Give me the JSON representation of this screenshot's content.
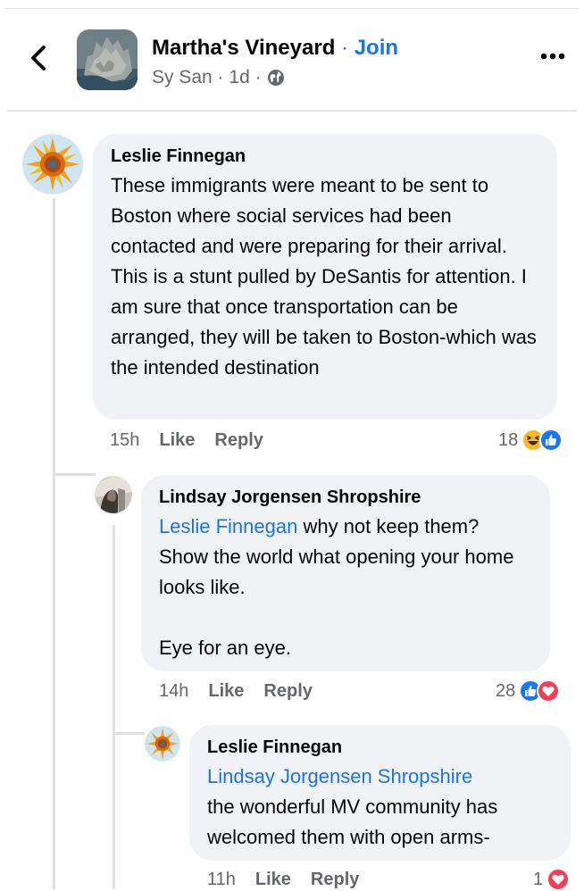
{
  "header": {
    "group_name": "Martha's Vineyard",
    "separator": " · ",
    "join_label": "Join",
    "author": "Sy San",
    "time": "1d"
  },
  "comments": [
    {
      "author": "Leslie Finnegan",
      "mention": "",
      "text": "These immigrants were meant to be sent to Boston where social services had been contacted and were preparing for their arrival. This is a stunt pulled by DeSantis for attention. I am sure that once transportation can be arranged, they will be taken to Boston-which was the intended destination",
      "time": "15h",
      "like_label": "Like",
      "reply_label": "Reply",
      "reaction_count": "18",
      "reactions": [
        "haha-icon",
        "like-icon"
      ]
    },
    {
      "author": "Lindsay Jorgensen Shropshire",
      "mention": "Leslie Finnegan",
      "text": " why not keep them? Show the world what opening your home looks like.",
      "text2": "Eye for an eye.",
      "time": "14h",
      "like_label": "Like",
      "reply_label": "Reply",
      "reaction_count": "28",
      "reactions": [
        "like-icon",
        "love-icon"
      ]
    },
    {
      "author": "Leslie Finnegan",
      "mention": "Lindsay Jorgensen Shropshire",
      "text": "the wonderful MV community has welcomed them with open arms-",
      "time": "11h",
      "like_label": "Like",
      "reply_label": "Reply",
      "reaction_count": "1",
      "reactions": [
        "love-icon"
      ]
    }
  ],
  "colors": {
    "link": "#1b74e4",
    "muted": "#65676b",
    "bubble": "#f0f2f5",
    "like": "#1877f2",
    "love": "#f33e58",
    "haha": "#f7b928"
  }
}
